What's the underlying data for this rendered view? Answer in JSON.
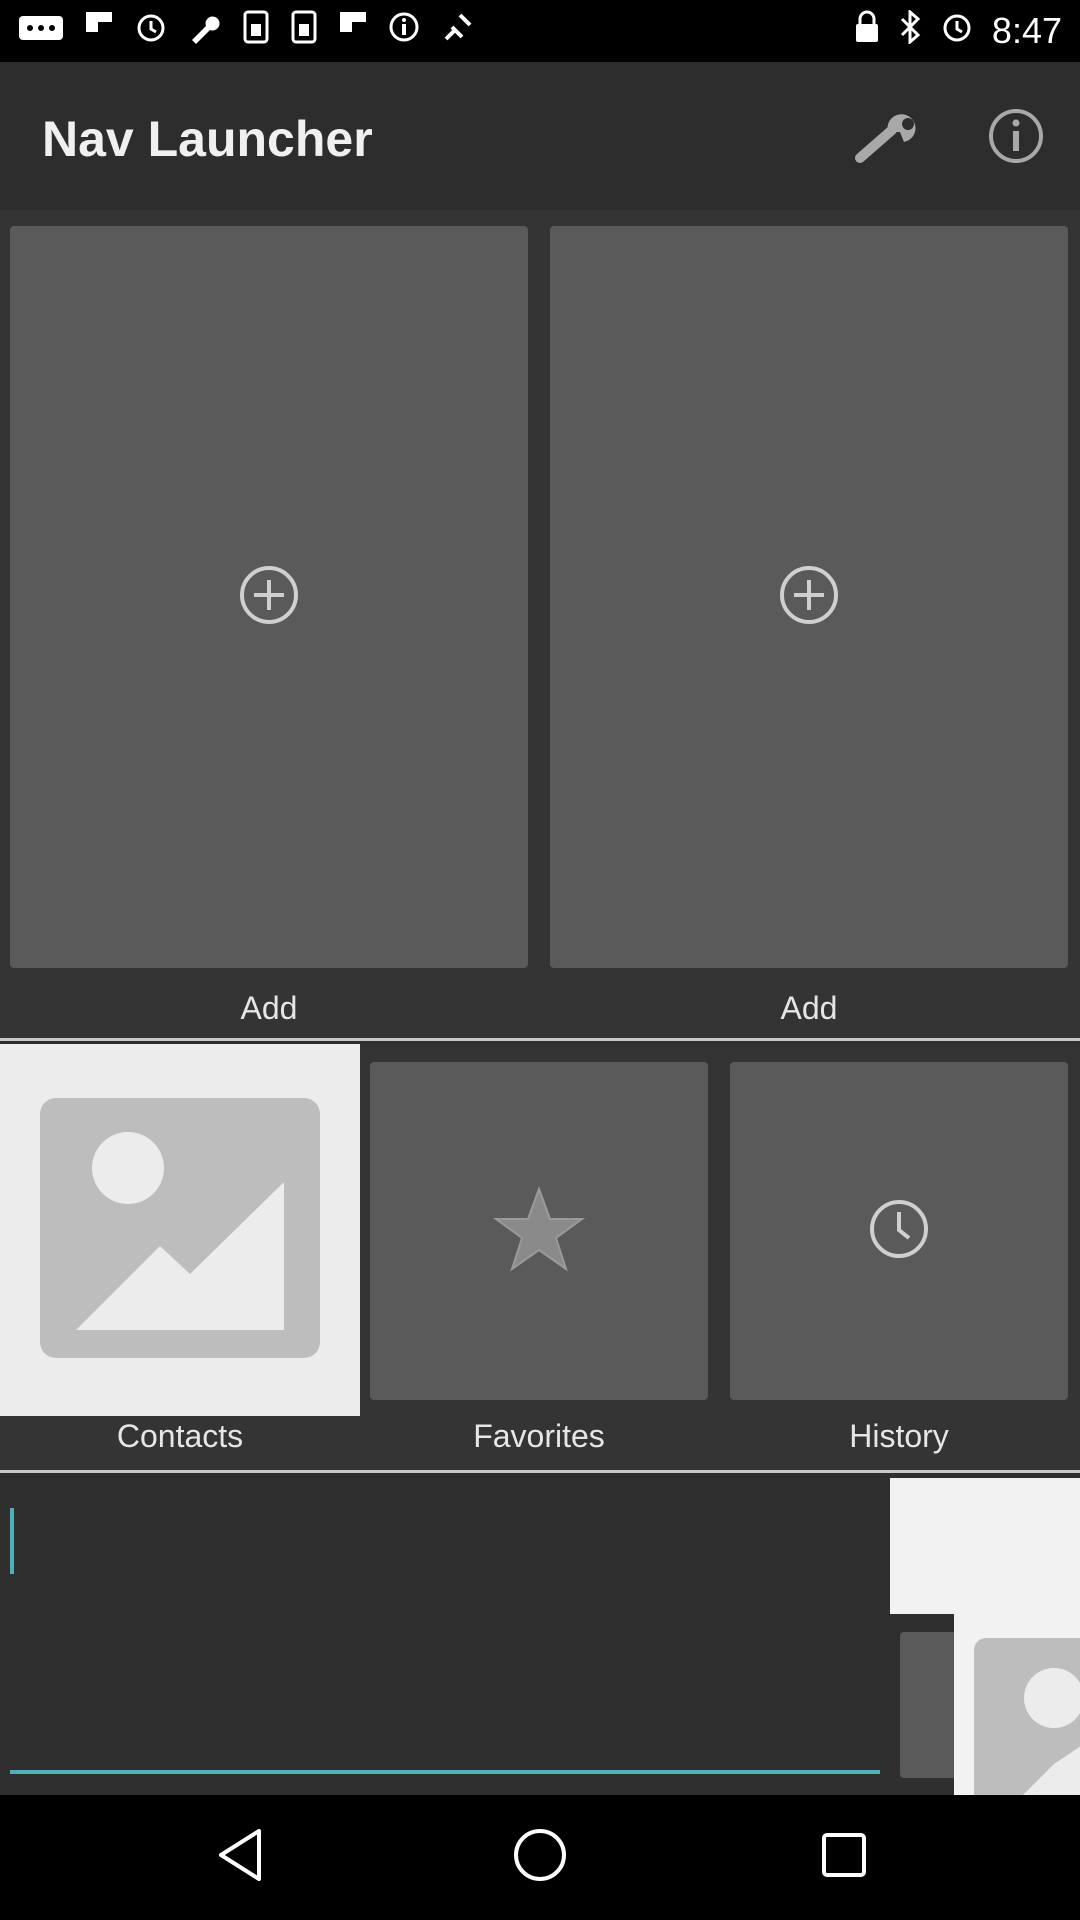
{
  "status_bar": {
    "time": "8:47",
    "left_icons": [
      "more-icon",
      "flipboard-icon",
      "alarm-icon",
      "wrench-icon",
      "sim-icon",
      "sim-icon",
      "flipboard-icon",
      "info-icon",
      "fake-gps-icon"
    ],
    "right_icons": [
      "lock-icon",
      "bluetooth-icon",
      "alarm-icon"
    ]
  },
  "app_bar": {
    "title": "Nav Launcher",
    "settings_icon": "wrench-icon",
    "info_icon": "info-icon"
  },
  "favorites_row": [
    {
      "label": "Add",
      "icon": "plus-circle-icon"
    },
    {
      "label": "Add",
      "icon": "plus-circle-icon"
    }
  ],
  "shortcuts": [
    {
      "label": "Contacts",
      "icon": "image-placeholder-icon"
    },
    {
      "label": "Favorites",
      "icon": "star-icon"
    },
    {
      "label": "History",
      "icon": "clock-icon"
    }
  ],
  "search": {
    "value": "",
    "accent_color": "#4fb0b8"
  },
  "nav_bar": {
    "buttons": [
      "back-icon",
      "home-icon",
      "recents-icon"
    ]
  }
}
